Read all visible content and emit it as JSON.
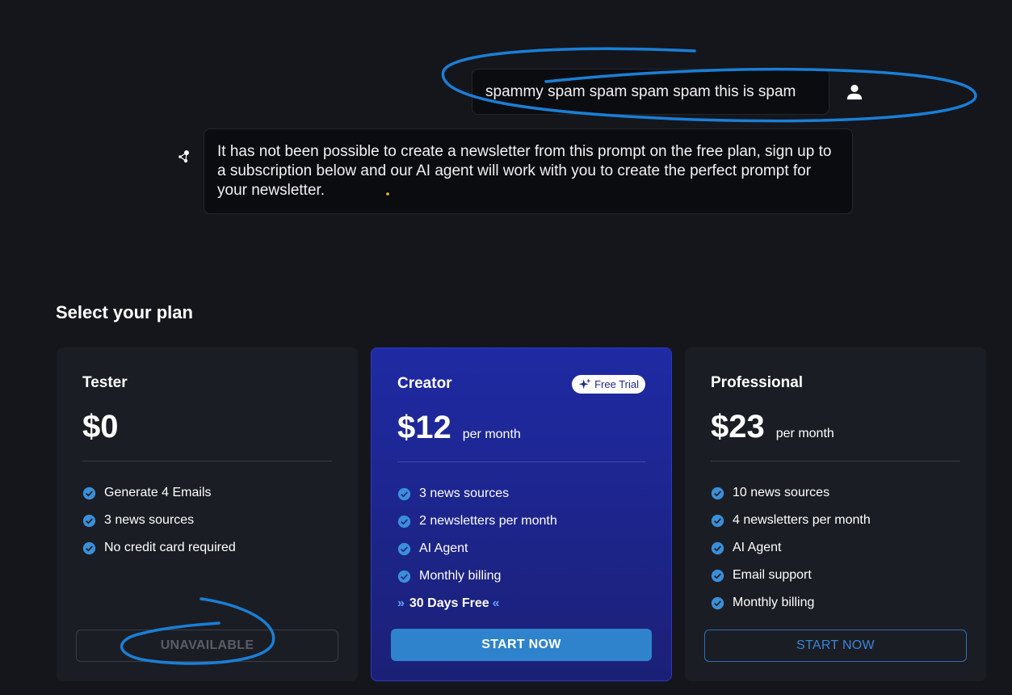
{
  "chat": {
    "user_message": "spammy spam spam spam spam this is spam",
    "bot_message": "It has not been possible to create a newsletter from this prompt on the free plan, sign up to a subscription below and our AI agent will work with you to create the perfect prompt for your newsletter.",
    "user_icon": "user-icon",
    "bot_icon": "ai-nodes-icon"
  },
  "plans_section": {
    "title": "Select your plan",
    "plans": [
      {
        "name": "Tester",
        "price": "$0",
        "period": "",
        "features": [
          "Generate 4 Emails",
          "3 news sources",
          "No credit card required"
        ],
        "button": "UNAVAILABLE"
      },
      {
        "name": "Creator",
        "badge": "Free Trial",
        "price": "$12",
        "period": "per month",
        "features": [
          "3 news sources",
          "2 newsletters per month",
          "AI Agent",
          "Monthly billing"
        ],
        "promo": "30 Days Free",
        "button": "START NOW"
      },
      {
        "name": "Professional",
        "price": "$23",
        "period": "per month",
        "features": [
          "10 news sources",
          "4 newsletters per month",
          "AI Agent",
          "Email support",
          "Monthly billing"
        ],
        "button": "START NOW"
      }
    ]
  },
  "colors": {
    "background": "#14161c",
    "card": "#1b1d24",
    "creator_card": "#1f2aa3",
    "accent": "#2f83cc",
    "check": "#3b8fd9",
    "annotation": "#1a7fd6"
  }
}
